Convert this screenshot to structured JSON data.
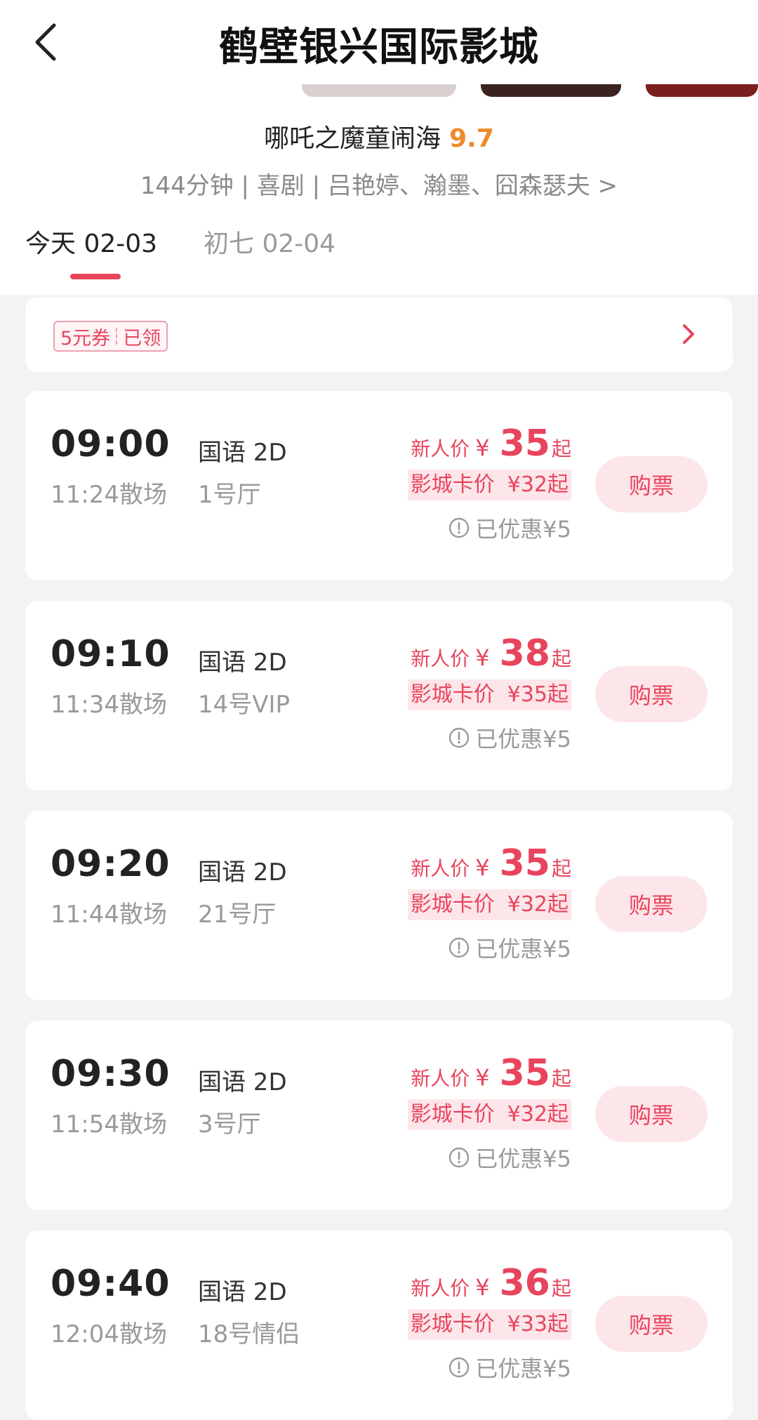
{
  "header": {
    "title": "鹤壁银兴国际影城"
  },
  "movie": {
    "title": "哪吒之魔童闹海",
    "score": "9.7",
    "meta": "144分钟 | 喜剧 | 吕艳婷、瀚墨、囧森瑟夫 >"
  },
  "dates": [
    {
      "label": "今天 02-03",
      "active": true
    },
    {
      "label": "初七 02-04",
      "active": false
    }
  ],
  "coupon": {
    "amount": "5元券",
    "status": "已领"
  },
  "showtimes": [
    {
      "start": "09:00",
      "end": "11:24散场",
      "lang": "国语 2D",
      "hall": "1号厅",
      "new_label": "新人价",
      "yen": "¥",
      "new_price": "35",
      "qi": "起",
      "card_label": "影城卡价",
      "card_price": "¥32起",
      "discount": "已优惠¥5",
      "buy": "购票"
    },
    {
      "start": "09:10",
      "end": "11:34散场",
      "lang": "国语 2D",
      "hall": "14号VIP",
      "new_label": "新人价",
      "yen": "¥",
      "new_price": "38",
      "qi": "起",
      "card_label": "影城卡价",
      "card_price": "¥35起",
      "discount": "已优惠¥5",
      "buy": "购票"
    },
    {
      "start": "09:20",
      "end": "11:44散场",
      "lang": "国语 2D",
      "hall": "21号厅",
      "new_label": "新人价",
      "yen": "¥",
      "new_price": "35",
      "qi": "起",
      "card_label": "影城卡价",
      "card_price": "¥32起",
      "discount": "已优惠¥5",
      "buy": "购票"
    },
    {
      "start": "09:30",
      "end": "11:54散场",
      "lang": "国语 2D",
      "hall": "3号厅",
      "new_label": "新人价",
      "yen": "¥",
      "new_price": "35",
      "qi": "起",
      "card_label": "影城卡价",
      "card_price": "¥32起",
      "discount": "已优惠¥5",
      "buy": "购票"
    },
    {
      "start": "09:40",
      "end": "12:04散场",
      "lang": "国语 2D",
      "hall": "18号情侣",
      "new_label": "新人价",
      "yen": "¥",
      "new_price": "36",
      "qi": "起",
      "card_label": "影城卡价",
      "card_price": "¥33起",
      "discount": "已优惠¥5",
      "buy": "购票"
    }
  ],
  "colors": {
    "accent": "#e8455d",
    "score": "#ef8a2b",
    "button_bg": "#fde6ea"
  },
  "icons": {
    "back": "chevron-left-icon",
    "coupon_arrow": "chevron-right-icon",
    "info": "info-circle-icon"
  }
}
